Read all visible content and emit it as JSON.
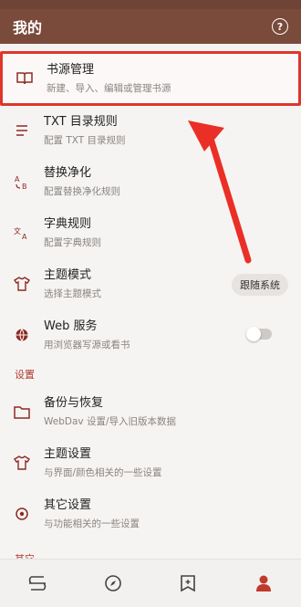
{
  "app": {
    "title": "我的"
  },
  "menu": [
    {
      "title": "书源管理",
      "subtitle": "新建、导入、编辑或管理书源"
    },
    {
      "title": "TXT 目录规则",
      "subtitle": "配置 TXT 目录规则"
    },
    {
      "title": "替换净化",
      "subtitle": "配置替换净化规则"
    },
    {
      "title": "字典规则",
      "subtitle": "配置字典规则"
    },
    {
      "title": "主题模式",
      "subtitle": "选择主题模式",
      "value": "跟随系统"
    },
    {
      "title": "Web 服务",
      "subtitle": "用浏览器写源或看书",
      "toggle": false
    }
  ],
  "settings": {
    "label": "设置",
    "items": [
      {
        "title": "备份与恢复",
        "subtitle": "WebDav 设置/导入旧版本数据"
      },
      {
        "title": "主题设置",
        "subtitle": "与界面/颜色相关的一些设置"
      },
      {
        "title": "其它设置",
        "subtitle": "与功能相关的一些设置"
      }
    ]
  },
  "other": {
    "label": "其它"
  },
  "colors": {
    "accent": "#8d2a24",
    "appbar": "#7a4a3a",
    "highlight": "#e0352b"
  },
  "bottom_tabs": [
    "bookshelf-icon",
    "explore-icon",
    "rss-bookmark-icon",
    "my-icon"
  ]
}
